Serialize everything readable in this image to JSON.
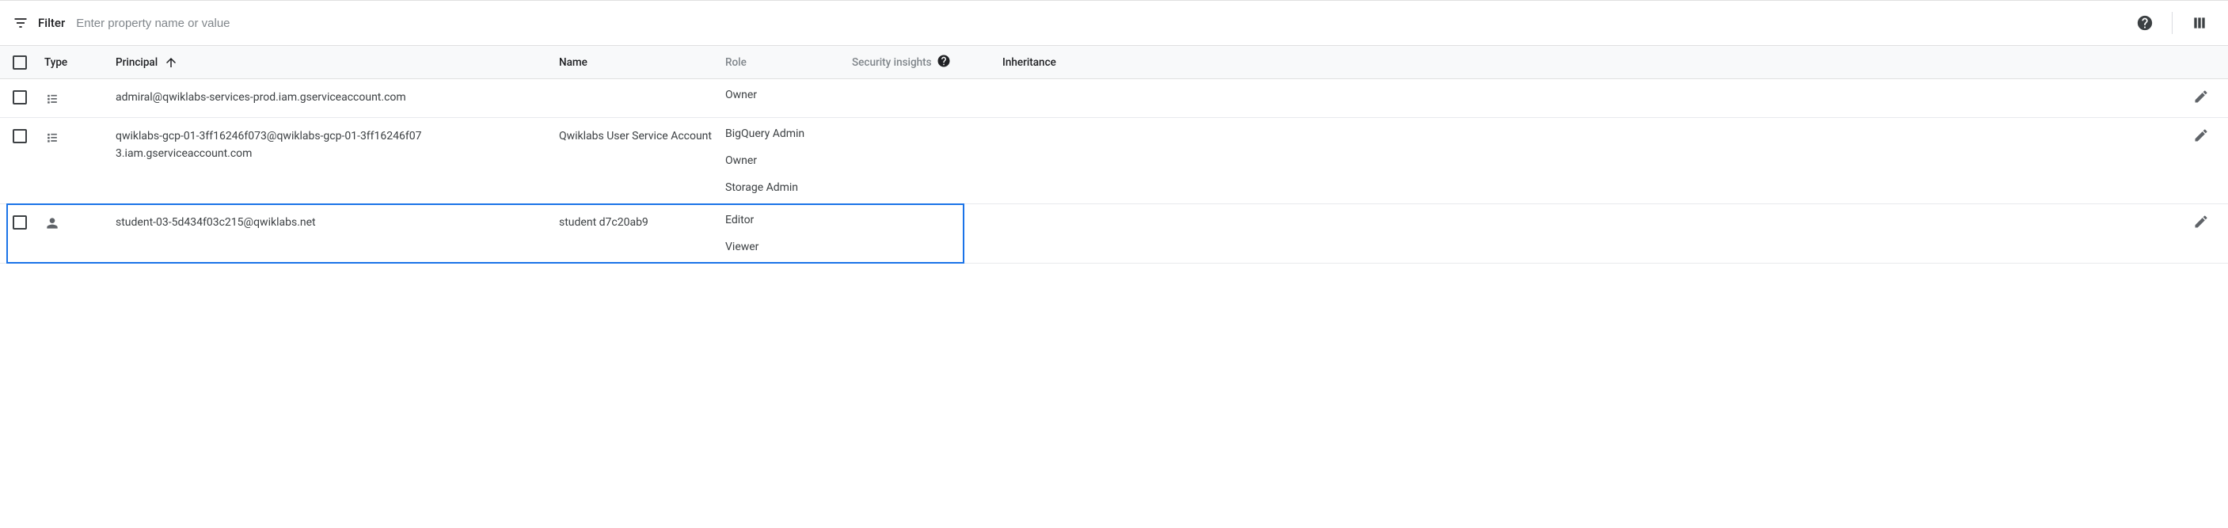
{
  "filter": {
    "label": "Filter",
    "placeholder": "Enter property name or value"
  },
  "columns": {
    "type": "Type",
    "principal": "Principal",
    "name": "Name",
    "role": "Role",
    "security_insights": "Security insights",
    "inheritance": "Inheritance"
  },
  "rows": [
    {
      "type_icon": "service-account",
      "principal": "admiral@qwiklabs-services-prod.iam.gserviceaccount.com",
      "name": "",
      "roles": [
        "Owner"
      ],
      "highlighted": false
    },
    {
      "type_icon": "service-account",
      "principal": "qwiklabs-gcp-01-3ff16246f073@qwiklabs-gcp-01-3ff16246f073.iam.gserviceaccount.com",
      "name": "Qwiklabs User Service Account",
      "roles": [
        "BigQuery Admin",
        "Owner",
        "Storage Admin"
      ],
      "highlighted": false
    },
    {
      "type_icon": "user",
      "principal": "student-03-5d434f03c215@qwiklabs.net",
      "name": "student d7c20ab9",
      "roles": [
        "Editor",
        "Viewer"
      ],
      "highlighted": true
    }
  ]
}
